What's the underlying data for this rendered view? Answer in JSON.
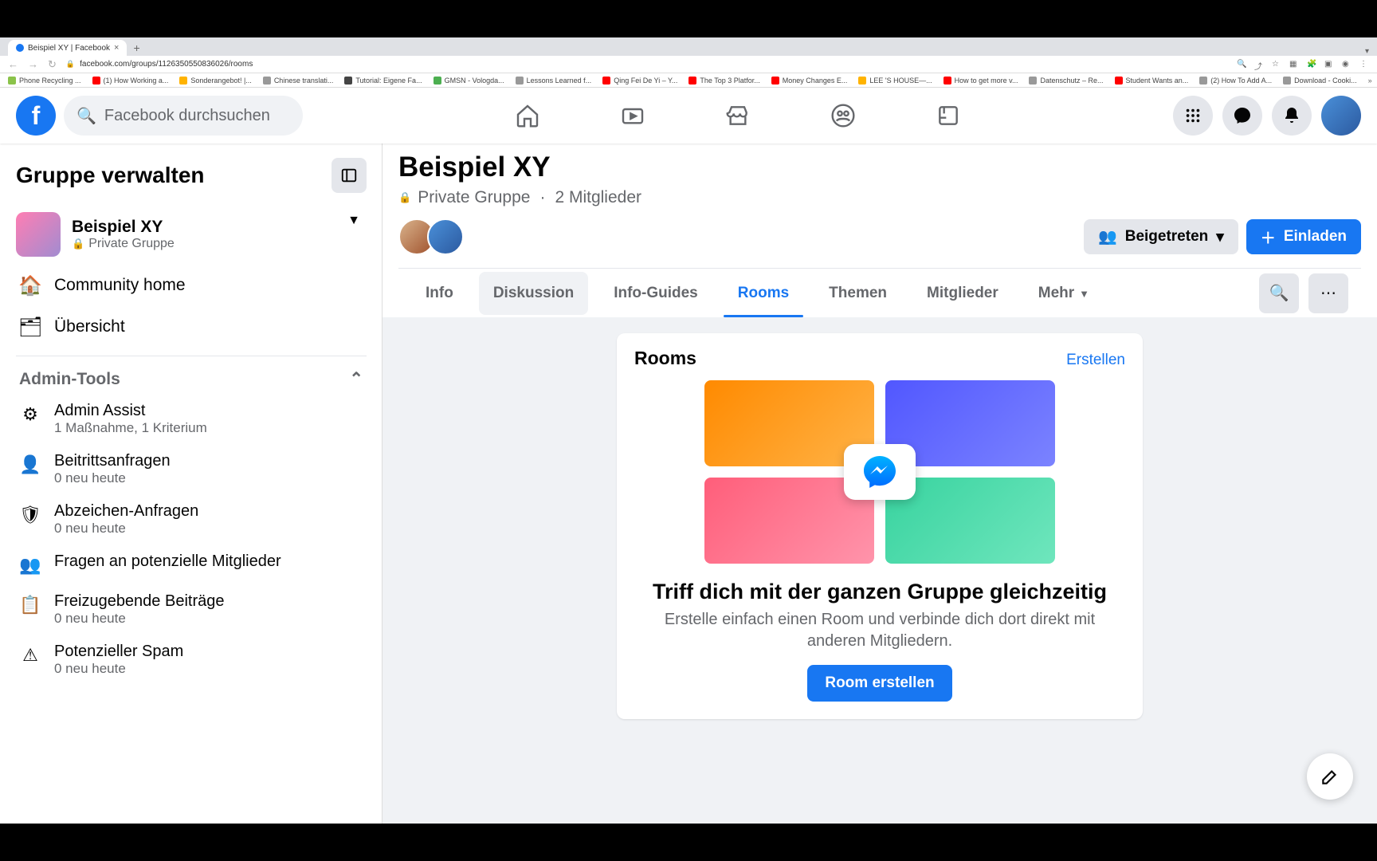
{
  "browser": {
    "tab_title": "Beispiel XY | Facebook",
    "url": "facebook.com/groups/1126350550836026/rooms",
    "bookmarks": [
      "Phone Recycling ...",
      "(1) How Working a...",
      "Sonderangebot! |...",
      "Chinese translati...",
      "Tutorial: Eigene Fa...",
      "GMSN - Vologda...",
      "Lessons Learned f...",
      "Qing Fei De Yi – Y...",
      "The Top 3 Platfor...",
      "Money Changes E...",
      "LEE 'S HOUSE—...",
      "How to get more v...",
      "Datenschutz – Re...",
      "Student Wants an...",
      "(2) How To Add A...",
      "Download - Cooki..."
    ]
  },
  "header": {
    "search_placeholder": "Facebook durchsuchen"
  },
  "sidebar": {
    "title": "Gruppe verwalten",
    "group_name": "Beispiel XY",
    "group_privacy": "Private Gruppe",
    "nav": {
      "community": "Community home",
      "overview": "Übersicht"
    },
    "admin_tools_label": "Admin-Tools",
    "items": [
      {
        "label": "Admin Assist",
        "sub": "1 Maßnahme, 1 Kriterium",
        "icon": "⚙"
      },
      {
        "label": "Beitrittsanfragen",
        "sub": "0 neu heute",
        "icon": "👤"
      },
      {
        "label": "Abzeichen-Anfragen",
        "sub": "0 neu heute",
        "icon": "🛡"
      },
      {
        "label": "Fragen an potenzielle Mitglieder",
        "sub": "",
        "icon": "👥"
      },
      {
        "label": "Freizugebende Beiträge",
        "sub": "0 neu heute",
        "icon": "📋"
      },
      {
        "label": "Potenzieller Spam",
        "sub": "0 neu heute",
        "icon": "⚠"
      }
    ]
  },
  "page": {
    "title": "Beispiel XY",
    "privacy": "Private Gruppe",
    "members": "2 Mitglieder",
    "joined_label": "Beigetreten",
    "invite_label": "Einladen",
    "tabs": [
      "Info",
      "Diskussion",
      "Info-Guides",
      "Rooms",
      "Themen",
      "Mitglieder",
      "Mehr"
    ],
    "active_tab_index": 3,
    "hover_tab_index": 1
  },
  "rooms": {
    "title": "Rooms",
    "create_link": "Erstellen",
    "heading": "Triff dich mit der ganzen Gruppe gleichzeitig",
    "body": "Erstelle einfach einen Room und verbinde dich dort direkt mit anderen Mitgliedern.",
    "button": "Room erstellen"
  }
}
